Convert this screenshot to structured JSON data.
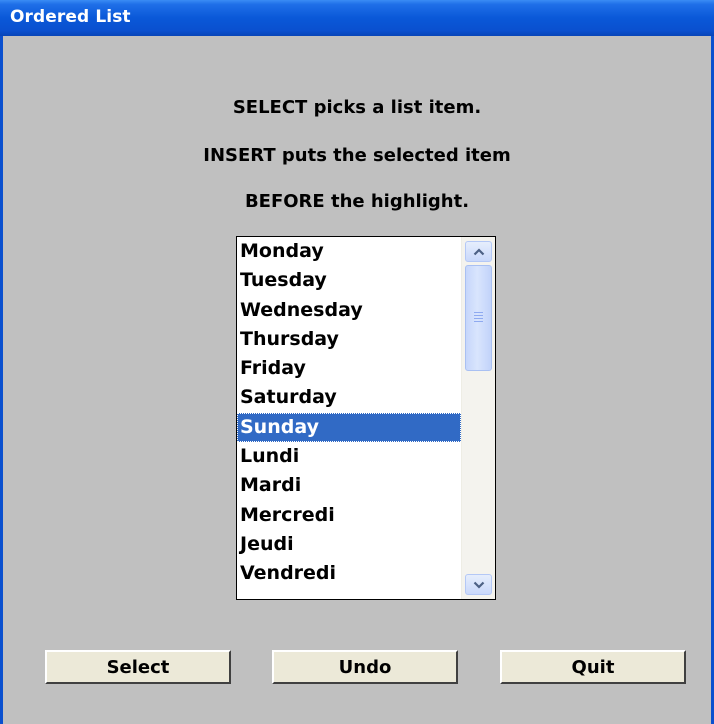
{
  "window": {
    "title": "Ordered List"
  },
  "instructions": {
    "line1": "SELECT picks a list item.",
    "line2": "INSERT puts the selected item",
    "line3": "BEFORE the highlight."
  },
  "list": {
    "items": [
      "Monday",
      "Tuesday",
      "Wednesday",
      "Thursday",
      "Friday",
      "Saturday",
      "Sunday",
      "Lundi",
      "Mardi",
      "Mercredi",
      "Jeudi",
      "Vendredi"
    ],
    "selected_index": 6,
    "scroll_position_fraction": 0
  },
  "buttons": {
    "select_label": "Select",
    "undo_label": "Undo",
    "quit_label": "Quit"
  },
  "icons": {
    "scroll_up": "chevron-up-icon",
    "scroll_down": "chevron-down-icon"
  },
  "colors": {
    "titlebar": "#0a58d8",
    "background": "#c0c0c0",
    "selection": "#316ac5",
    "button_face": "#ece9d8"
  }
}
